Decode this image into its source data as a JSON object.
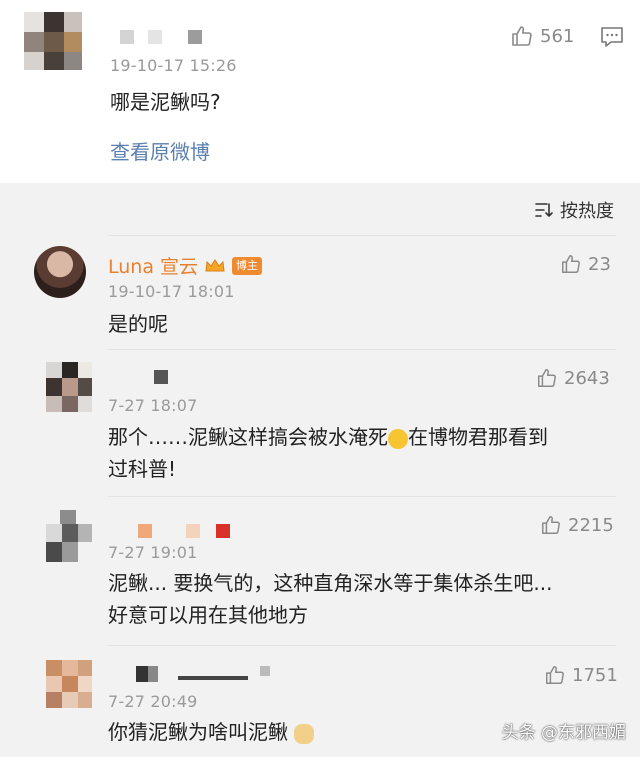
{
  "top_comment": {
    "timestamp": "19-10-17 15:26",
    "text": "哪是泥鳅吗?",
    "likes": "561",
    "view_original": "查看原微博"
  },
  "sort": {
    "label": "按热度"
  },
  "replies": [
    {
      "author": "Luna 宣云",
      "badge": "博主",
      "timestamp": "19-10-17 18:01",
      "text": "是的呢",
      "likes": "23"
    },
    {
      "timestamp": "7-27 18:07",
      "text_line1": "那个……泥鳅这样搞会被水淹死",
      "text_line1b": "在博物君那看到",
      "text_line2": "过科普!",
      "likes": "2643"
    },
    {
      "timestamp": "7-27 19:01",
      "text_line1": "泥鳅... 要换气的，这种直角深水等于集体杀生吧...",
      "text_line2": "好意可以用在其他地方",
      "likes": "2215"
    },
    {
      "timestamp": "7-27 20:49",
      "text": "你猜泥鳅为啥叫泥鳅",
      "likes": "1751"
    }
  ],
  "watermark": "头条 @东邪西媚",
  "icons": {
    "like": "thumbs-up-icon",
    "comment": "comment-icon",
    "sort": "sort-icon"
  }
}
